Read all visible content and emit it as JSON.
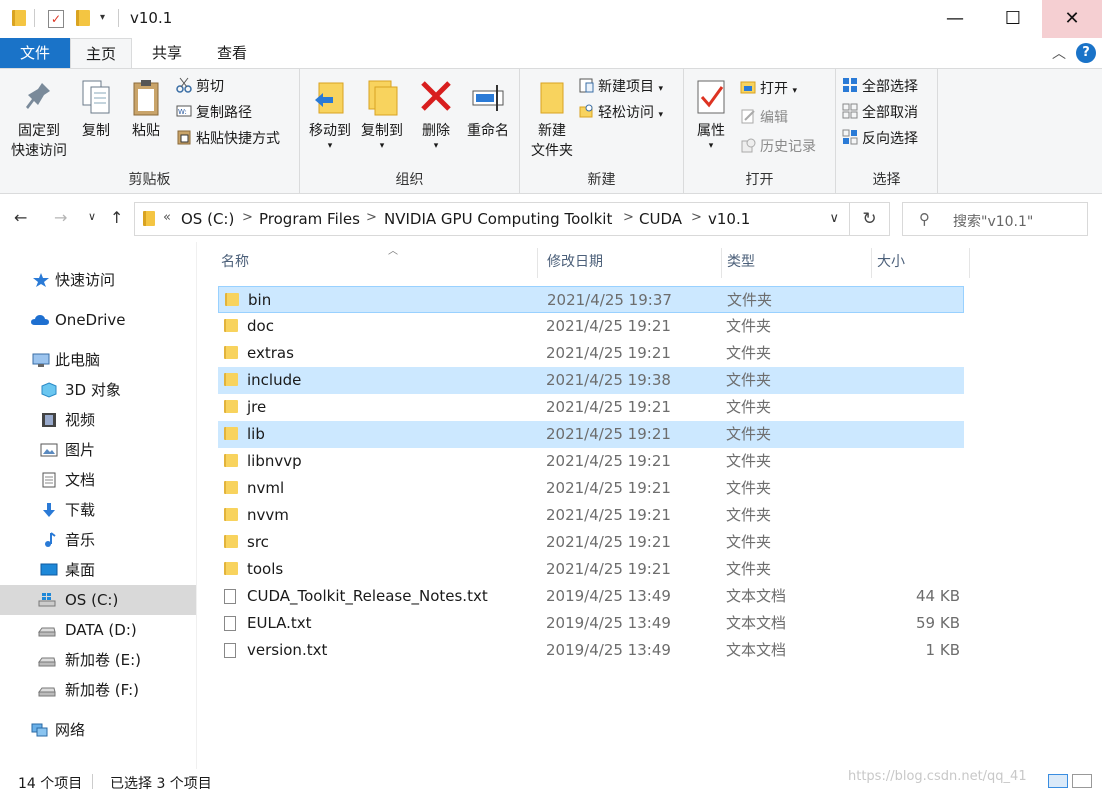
{
  "window": {
    "title": "v10.1",
    "minimize_glyph": "—",
    "maximize_glyph": "☐",
    "close_glyph": "✕"
  },
  "tabs": {
    "file": "文件",
    "home": "主页",
    "share": "共享",
    "view": "查看",
    "help_glyph": "?"
  },
  "ribbon": {
    "clipboard": {
      "label": "剪贴板",
      "pin_line1": "固定到",
      "pin_line2": "快速访问",
      "copy": "复制",
      "paste": "粘贴",
      "cut": "剪切",
      "copy_path": "复制路径",
      "paste_shortcut": "粘贴快捷方式"
    },
    "organize": {
      "label": "组织",
      "move_to": "移动到",
      "copy_to": "复制到",
      "delete": "删除",
      "rename": "重命名"
    },
    "new": {
      "label": "新建",
      "new_folder_line1": "新建",
      "new_folder_line2": "文件夹",
      "new_item": "新建项目",
      "easy_access": "轻松访问"
    },
    "open": {
      "label": "打开",
      "properties": "属性",
      "open": "打开",
      "edit": "编辑",
      "history": "历史记录"
    },
    "select": {
      "label": "选择",
      "select_all": "全部选择",
      "select_none": "全部取消",
      "invert": "反向选择"
    }
  },
  "address": {
    "prefix": "«",
    "crumbs": [
      "OS (C:)",
      "Program Files",
      "NVIDIA GPU Computing Toolkit",
      "CUDA",
      "v10.1"
    ],
    "separator": ">",
    "search_placeholder": "搜索\"v10.1\""
  },
  "sidebar": {
    "items": [
      {
        "label": "快速访问",
        "icon": "star-icon"
      },
      {
        "label": "OneDrive",
        "icon": "cloud-icon"
      },
      {
        "label": "此电脑",
        "icon": "computer-icon"
      },
      {
        "label": "3D 对象",
        "icon": "cube-icon"
      },
      {
        "label": "视频",
        "icon": "film-icon"
      },
      {
        "label": "图片",
        "icon": "picture-icon"
      },
      {
        "label": "文档",
        "icon": "document-icon"
      },
      {
        "label": "下载",
        "icon": "download-icon"
      },
      {
        "label": "音乐",
        "icon": "music-icon"
      },
      {
        "label": "桌面",
        "icon": "desktop-icon"
      },
      {
        "label": "OS (C:)",
        "icon": "windows-drive-icon"
      },
      {
        "label": "DATA (D:)",
        "icon": "drive-icon"
      },
      {
        "label": "新加卷 (E:)",
        "icon": "drive-icon"
      },
      {
        "label": "新加卷 (F:)",
        "icon": "drive-icon"
      },
      {
        "label": "网络",
        "icon": "network-icon"
      }
    ]
  },
  "columns": {
    "name": "名称",
    "date": "修改日期",
    "type": "类型",
    "size": "大小"
  },
  "files": [
    {
      "name": "bin",
      "date": "2021/4/25 19:37",
      "type": "文件夹",
      "size": "",
      "kind": "folder",
      "selected": true
    },
    {
      "name": "doc",
      "date": "2021/4/25 19:21",
      "type": "文件夹",
      "size": "",
      "kind": "folder",
      "selected": false
    },
    {
      "name": "extras",
      "date": "2021/4/25 19:21",
      "type": "文件夹",
      "size": "",
      "kind": "folder",
      "selected": false
    },
    {
      "name": "include",
      "date": "2021/4/25 19:38",
      "type": "文件夹",
      "size": "",
      "kind": "folder",
      "selected": true
    },
    {
      "name": "jre",
      "date": "2021/4/25 19:21",
      "type": "文件夹",
      "size": "",
      "kind": "folder",
      "selected": false
    },
    {
      "name": "lib",
      "date": "2021/4/25 19:21",
      "type": "文件夹",
      "size": "",
      "kind": "folder",
      "selected": true
    },
    {
      "name": "libnvvp",
      "date": "2021/4/25 19:21",
      "type": "文件夹",
      "size": "",
      "kind": "folder",
      "selected": false
    },
    {
      "name": "nvml",
      "date": "2021/4/25 19:21",
      "type": "文件夹",
      "size": "",
      "kind": "folder",
      "selected": false
    },
    {
      "name": "nvvm",
      "date": "2021/4/25 19:21",
      "type": "文件夹",
      "size": "",
      "kind": "folder",
      "selected": false
    },
    {
      "name": "src",
      "date": "2021/4/25 19:21",
      "type": "文件夹",
      "size": "",
      "kind": "folder",
      "selected": false
    },
    {
      "name": "tools",
      "date": "2021/4/25 19:21",
      "type": "文件夹",
      "size": "",
      "kind": "folder",
      "selected": false
    },
    {
      "name": "CUDA_Toolkit_Release_Notes.txt",
      "date": "2019/4/25 13:49",
      "type": "文本文档",
      "size": "44 KB",
      "kind": "text",
      "selected": false
    },
    {
      "name": "EULA.txt",
      "date": "2019/4/25 13:49",
      "type": "文本文档",
      "size": "59 KB",
      "kind": "text",
      "selected": false
    },
    {
      "name": "version.txt",
      "date": "2019/4/25 13:49",
      "type": "文本文档",
      "size": "1 KB",
      "kind": "text",
      "selected": false
    }
  ],
  "status": {
    "count": "14 个项目",
    "selected": "已选择 3 个项目",
    "watermark": "https://blog.csdn.net/qq_41"
  },
  "colors": {
    "accent": "#1a73c8",
    "selection": "#cce8ff",
    "folder": "#f8d35e"
  }
}
